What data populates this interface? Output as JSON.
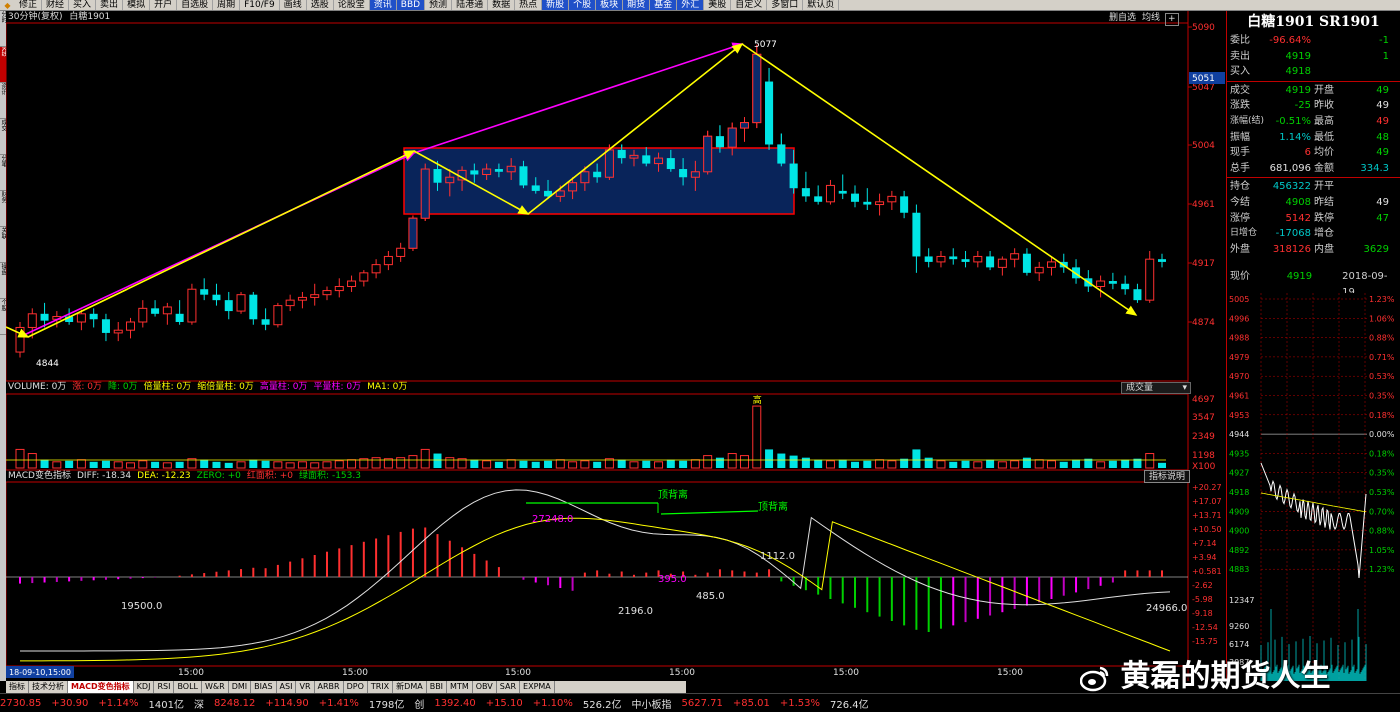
{
  "toolbar": {
    "items": [
      "修正",
      "财经",
      "买入",
      "卖出",
      "模拟",
      "开户",
      "自选股",
      "周期",
      "F10/F9",
      "画线",
      "选股",
      "论股堂",
      "资讯",
      "BBD",
      "预测",
      "陆港通",
      "数据",
      "热点",
      "新股",
      "个股",
      "板块",
      "期货",
      "基金",
      "外汇",
      "美股",
      "自定义",
      "多窗口",
      "默认页"
    ],
    "highlighted": [
      12,
      13,
      18,
      19,
      20,
      21,
      22,
      23
    ]
  },
  "leftstrip": [
    "分时",
    "K线",
    "资讯",
    "成交",
    "分笔",
    "财务",
    "关联",
    "操盘",
    "个股"
  ],
  "header": {
    "period_label": "30分钟(复权)",
    "symbol_name": "白糖1901",
    "btn_mid": "删自选",
    "btn_line": "均线",
    "btn_box": "+"
  },
  "price_axis": {
    "labels": [
      "5090",
      "5047",
      "5004",
      "4961",
      "4917",
      "4874"
    ],
    "current": "5051"
  },
  "annotations": {
    "high_label": "5077",
    "low_label": "4844"
  },
  "volume": {
    "legend": [
      {
        "t": "VOLUME: 0万",
        "c": "#e0e0e0"
      },
      {
        "t": "涨: 0万",
        "c": "#ff3030"
      },
      {
        "t": "降: 0万",
        "c": "#00d000"
      },
      {
        "t": "倍量柱: 0万",
        "c": "#ffff00"
      },
      {
        "t": "缩倍量柱: 0万",
        "c": "#ffff00"
      },
      {
        "t": "高量柱: 0万",
        "c": "#ff00ff"
      },
      {
        "t": "平量柱: 0万",
        "c": "#ff00ff"
      },
      {
        "t": "MA1: 0万",
        "c": "#ffff00"
      }
    ],
    "dropdown": "成交量",
    "axis": [
      "4697",
      "3547",
      "2349",
      "1198",
      "X100"
    ],
    "high_mark": "高"
  },
  "macd": {
    "legend": [
      {
        "t": "MACD变色指标",
        "c": "#e0e0e0"
      },
      {
        "t": "DIFF: -18.34",
        "c": "#e0e0e0"
      },
      {
        "t": "DEA: -12.23",
        "c": "#ffff00"
      },
      {
        "t": "ZERO: +0",
        "c": "#00d000"
      },
      {
        "t": "红面积: +0",
        "c": "#ff3030"
      },
      {
        "t": "绿面积: -153.3",
        "c": "#00d000"
      }
    ],
    "btn": "指标说明",
    "axis": [
      "+20.27",
      "+17.07",
      "+13.71",
      "+10.50",
      "+7.14",
      "+3.94",
      "+0.581",
      "-2.62",
      "-5.98",
      "-9.18",
      "-12.54",
      "-15.75"
    ],
    "labels": [
      {
        "t": "19500.0",
        "c": "#e0e0e0"
      },
      {
        "t": "2196.0",
        "c": "#e0e0e0"
      },
      {
        "t": "485.0",
        "c": "#e0e0e0"
      },
      {
        "t": "27248.0",
        "c": "#ff00ff"
      },
      {
        "t": "395.0",
        "c": "#ff00ff"
      },
      {
        "t": "1112.0",
        "c": "#e0e0e0"
      },
      {
        "t": "24966.0",
        "c": "#e0e0e0"
      },
      {
        "t": "顶背离",
        "c": "#00ff00"
      },
      {
        "t": "顶背离",
        "c": "#00ff00"
      }
    ]
  },
  "time_axis": {
    "start": "18-09-10,15:00",
    "labels": [
      "15:00",
      "15:00",
      "15:00",
      "15:00",
      "15:00",
      "15:00"
    ]
  },
  "quote": {
    "title": "白糖1901 SR1901",
    "rows1": [
      {
        "l": "委比",
        "v": "-96.64%",
        "vc": "red",
        "v2": "-1",
        "v2c": "green"
      },
      {
        "l": "卖出",
        "v": "4919",
        "vc": "green",
        "v2": "1",
        "v2c": "green"
      },
      {
        "l": "买入",
        "v": "4918",
        "vc": "green",
        "v2": "",
        "v2c": "green"
      }
    ],
    "rows2": [
      {
        "l": "成交",
        "v": "4919",
        "vc": "green",
        "l2": "开盘",
        "v2": "49",
        "v2c": "green"
      },
      {
        "l": "涨跌",
        "v": "-25",
        "vc": "green",
        "l2": "昨收",
        "v2": "49",
        "v2c": "wht"
      },
      {
        "l": "涨幅(结)",
        "v": "-0.51%",
        "vc": "green",
        "l2": "最高",
        "v2": "49",
        "v2c": "red"
      },
      {
        "l": "振幅",
        "v": "1.14%",
        "vc": "cyan",
        "l2": "最低",
        "v2": "48",
        "v2c": "green"
      },
      {
        "l": "现手",
        "v": "6",
        "vc": "red",
        "l2": "均价",
        "v2": "49",
        "v2c": "green"
      },
      {
        "l": "总手",
        "v": "681,096",
        "vc": "wht",
        "l2": "金额",
        "v2": "334.3",
        "v2c": "cyan"
      }
    ],
    "rows3": [
      {
        "l": "持仓",
        "v": "456322",
        "vc": "cyan",
        "l2": "开平",
        "v2": "",
        "v2c": "wht"
      },
      {
        "l": "今结",
        "v": "4908",
        "vc": "green",
        "l2": "昨结",
        "v2": "49",
        "v2c": "wht"
      },
      {
        "l": "涨停",
        "v": "5142",
        "vc": "red",
        "l2": "跌停",
        "v2": "47",
        "v2c": "green"
      },
      {
        "l": "日增仓",
        "v": "-17068",
        "vc": "cyan",
        "l2": "增仓",
        "v2": "",
        "v2c": "wht"
      },
      {
        "l": "外盘",
        "v": "318126",
        "vc": "red",
        "l2": "内盘",
        "v2": "3629",
        "v2c": "green"
      }
    ],
    "xianjia_label": "现价",
    "xianjia_val": "4919",
    "xianjia_date": "2018-09-19,",
    "mini_left": [
      "5005",
      "4996",
      "4988",
      "4979",
      "4970",
      "4961",
      "4953",
      "4944",
      "4935",
      "4927",
      "4918",
      "4909",
      "4900",
      "4892",
      "4883"
    ],
    "mini_right": [
      "1.23%",
      "1.06%",
      "0.88%",
      "0.71%",
      "0.53%",
      "0.35%",
      "0.18%",
      "0.00%",
      "0.18%",
      "0.35%",
      "0.53%",
      "0.70%",
      "0.88%",
      "1.05%",
      "1.23%"
    ],
    "mini_vol": [
      "12347",
      "9260",
      "6174",
      "3087"
    ]
  },
  "tabs": [
    "指标",
    "技术分析",
    "MACD变色指标",
    "KDJ",
    "RSI",
    "BOLL",
    "W&R",
    "DMI",
    "BIAS",
    "ASI",
    "VR",
    "ARBR",
    "DPO",
    "TRIX",
    "新DMA",
    "BBI",
    "MTM",
    "OBV",
    "SAR",
    "EXPMA"
  ],
  "tab_active": 2,
  "status": [
    {
      "t": "2730.85",
      "c": "#ff3030"
    },
    {
      "t": "+30.90",
      "c": "#ff3030"
    },
    {
      "t": "+1.14%",
      "c": "#ff3030"
    },
    {
      "t": "1401亿",
      "c": "#e0e0e0"
    },
    {
      "t": "深",
      "c": "#e0e0e0"
    },
    {
      "t": "8248.12",
      "c": "#ff3030"
    },
    {
      "t": "+114.90",
      "c": "#ff3030"
    },
    {
      "t": "+1.41%",
      "c": "#ff3030"
    },
    {
      "t": "1798亿",
      "c": "#e0e0e0"
    },
    {
      "t": "创",
      "c": "#e0e0e0"
    },
    {
      "t": "1392.40",
      "c": "#ff3030"
    },
    {
      "t": "+15.10",
      "c": "#ff3030"
    },
    {
      "t": "+1.10%",
      "c": "#ff3030"
    },
    {
      "t": "526.2亿",
      "c": "#e0e0e0"
    },
    {
      "t": "中小板指",
      "c": "#e0e0e0"
    },
    {
      "t": "5627.71",
      "c": "#ff3030"
    },
    {
      "t": "+85.01",
      "c": "#ff3030"
    },
    {
      "t": "+1.53%",
      "c": "#ff3030"
    },
    {
      "t": "726.4亿",
      "c": "#e0e0e0"
    }
  ],
  "watermark": "黄磊的期货人生",
  "colors": {
    "up": "#ff3030",
    "down": "#00e5e5",
    "box": "#ff0000",
    "arrow_yellow": "#ffff00",
    "arrow_magenta": "#ff00ff"
  }
}
